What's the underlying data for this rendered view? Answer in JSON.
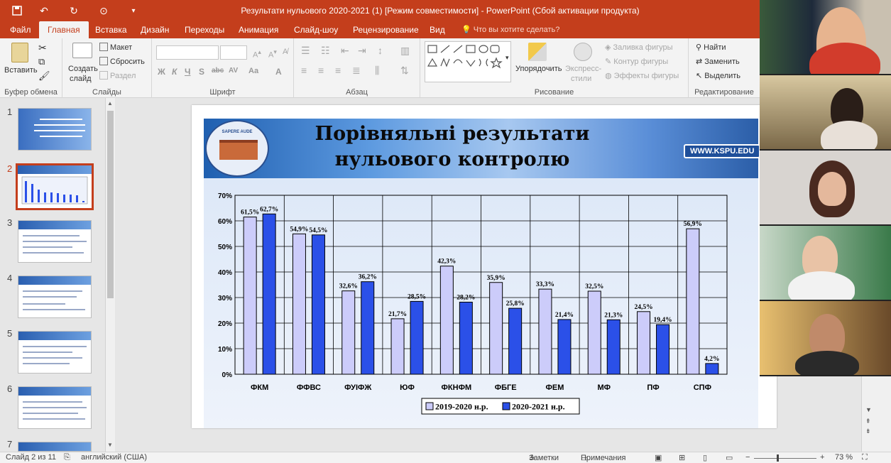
{
  "titlebar": {
    "title": "Результати нульового 2020-2021 (1) [Режим совместимости] - PowerPoint (Сбой активации продукта)"
  },
  "tabs": [
    "Файл",
    "Главная",
    "Вставка",
    "Дизайн",
    "Переходы",
    "Анимация",
    "Слайд-шоу",
    "Рецензирование",
    "Вид"
  ],
  "tell_me": "Что вы хотите сделать?",
  "ribbon": {
    "groups": [
      "Буфер обмена",
      "Слайды",
      "Шрифт",
      "Абзац",
      "Рисование",
      "Редактирование"
    ],
    "paste": "Вставить",
    "new_slide_1": "Создать",
    "new_slide_2": "слайд",
    "layout": "Макет",
    "reset": "Сбросить",
    "section": "Раздел",
    "arrange": "Упорядочить",
    "quick_styles_1": "Экспресс-",
    "quick_styles_2": "стили",
    "shape_fill": "Заливка фигуры",
    "shape_outline": "Контур фигуры",
    "shape_effects": "Эффекты фигуры",
    "find": "Найти",
    "replace": "Заменить",
    "select": "Выделить",
    "format_letters": [
      "Ж",
      "К",
      "Ч",
      "S",
      "abc",
      "AV",
      "Aa",
      "A"
    ]
  },
  "thumbs": {
    "numbers": [
      "1",
      "2",
      "3",
      "4",
      "5",
      "6",
      "7"
    ],
    "active_index": 1
  },
  "slide": {
    "title_line1": "Порівняльні результати",
    "title_line2": "нульового контролю",
    "website": "WWW.KSPU.EDU",
    "logo_text": "SAPERE AUDE"
  },
  "chart_data": {
    "type": "bar",
    "categories": [
      "ФКМ",
      "ФФВС",
      "ФУІФЖ",
      "ЮФ",
      "ФКНФМ",
      "ФБГЕ",
      "ФЕМ",
      "МФ",
      "ПФ",
      "СПФ"
    ],
    "series": [
      {
        "name": "2019-2020 н.р.",
        "values": [
          61.5,
          54.9,
          32.6,
          21.7,
          42.3,
          35.9,
          33.3,
          32.5,
          24.5,
          56.9
        ],
        "labels": [
          "61,5%",
          "54,9%",
          "32,6%",
          "21,7%",
          "42,3%",
          "35,9%",
          "33,3%",
          "32,5%",
          "24,5%",
          "56,9%"
        ],
        "color": "#ccccfa"
      },
      {
        "name": "2020-2021 н.р.",
        "values": [
          62.7,
          54.5,
          36.2,
          28.5,
          28.2,
          25.8,
          21.4,
          21.3,
          19.4,
          4.2
        ],
        "labels": [
          "62,7%",
          "54,5%",
          "36,2%",
          "28,5%",
          "28,2%",
          "25,8%",
          "21,4%",
          "21,3%",
          "19,4%",
          "4,2%"
        ],
        "color": "#2b50e8"
      }
    ],
    "yticks": [
      "0%",
      "10%",
      "20%",
      "30%",
      "40%",
      "50%",
      "60%",
      "70%"
    ],
    "ylim": [
      0,
      70
    ],
    "grid": true,
    "legend": "bottom"
  },
  "status": {
    "slide_info": "Слайд 2 из 11",
    "language": "английский (США)",
    "notes": "Заметки",
    "comments": "Примечания",
    "zoom": "73 %"
  }
}
